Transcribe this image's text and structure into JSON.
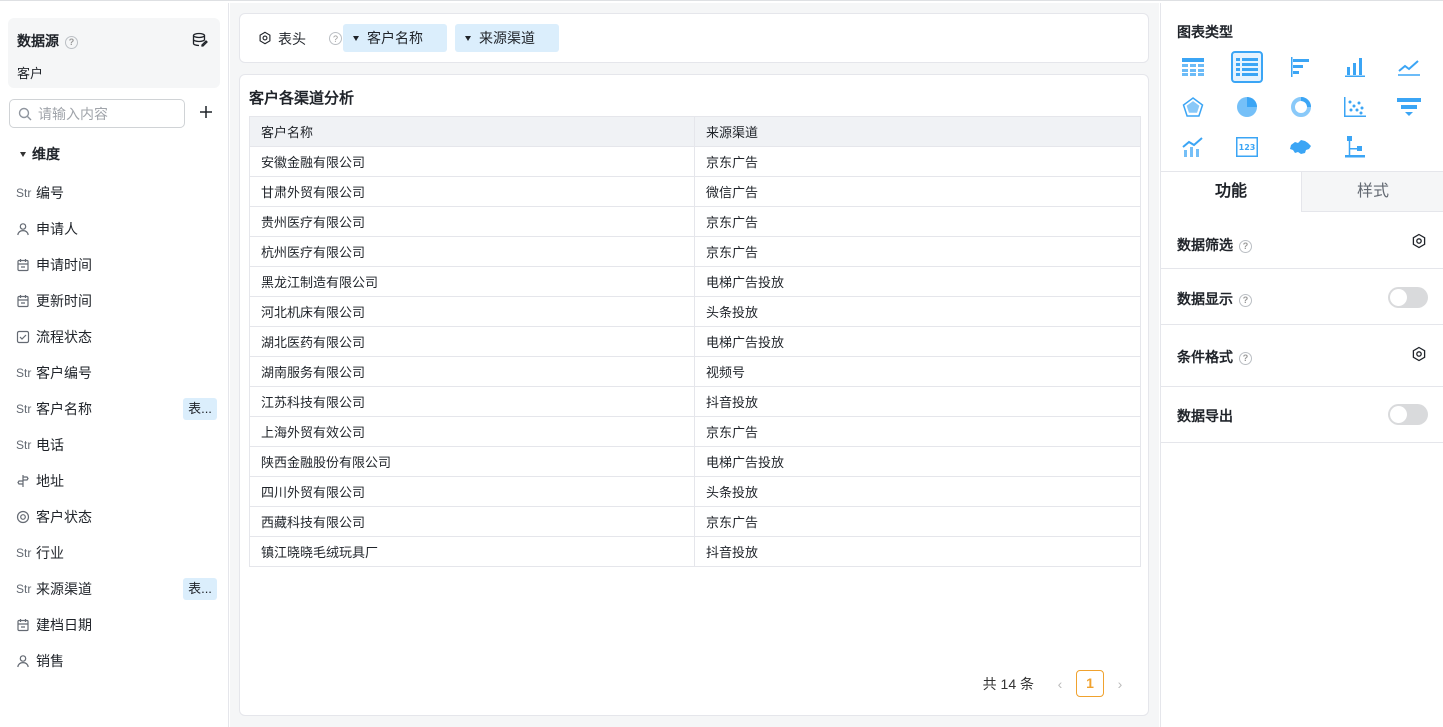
{
  "left": {
    "datasource_title": "数据源",
    "datasource_name": "客户",
    "search_placeholder": "请输入内容",
    "dimension_title": "维度",
    "fields": [
      {
        "type": "Str",
        "label": "编号",
        "tag": ""
      },
      {
        "type": "person-icon",
        "label": "申请人",
        "tag": ""
      },
      {
        "type": "calendar-icon",
        "label": "申请时间",
        "tag": ""
      },
      {
        "type": "calendar-icon",
        "label": "更新时间",
        "tag": ""
      },
      {
        "type": "checkbox-icon",
        "label": "流程状态",
        "tag": ""
      },
      {
        "type": "Str",
        "label": "客户编号",
        "tag": ""
      },
      {
        "type": "Str",
        "label": "客户名称",
        "tag": "表..."
      },
      {
        "type": "Str",
        "label": "电话",
        "tag": ""
      },
      {
        "type": "location-icon",
        "label": "地址",
        "tag": ""
      },
      {
        "type": "radio-icon",
        "label": "客户状态",
        "tag": ""
      },
      {
        "type": "Str",
        "label": "行业",
        "tag": ""
      },
      {
        "type": "Str",
        "label": "来源渠道",
        "tag": "表..."
      },
      {
        "type": "calendar-icon",
        "label": "建档日期",
        "tag": ""
      },
      {
        "type": "person-icon",
        "label": "销售",
        "tag": ""
      }
    ]
  },
  "header": {
    "label": "表头",
    "pills": [
      "客户名称",
      "来源渠道"
    ]
  },
  "table": {
    "title": "客户各渠道分析",
    "columns": [
      "客户名称",
      "来源渠道"
    ],
    "rows": [
      [
        "安徽金融有限公司",
        "京东广告"
      ],
      [
        "甘肃外贸有限公司",
        "微信广告"
      ],
      [
        "贵州医疗有限公司",
        "京东广告"
      ],
      [
        "杭州医疗有限公司",
        "京东广告"
      ],
      [
        "黑龙江制造有限公司",
        "电梯广告投放"
      ],
      [
        "河北机床有限公司",
        "头条投放"
      ],
      [
        "湖北医药有限公司",
        "电梯广告投放"
      ],
      [
        "湖南服务有限公司",
        "视频号"
      ],
      [
        "江苏科技有限公司",
        "抖音投放"
      ],
      [
        "上海外贸有效公司",
        "京东广告"
      ],
      [
        "陕西金融股份有限公司",
        "电梯广告投放"
      ],
      [
        "四川外贸有限公司",
        "头条投放"
      ],
      [
        "西藏科技有限公司",
        "京东广告"
      ],
      [
        "镇江晓晓毛绒玩具厂",
        "抖音投放"
      ]
    ],
    "total": "共 14 条",
    "page": "1"
  },
  "right": {
    "chart_type_title": "图表类型",
    "chart_types": [
      "table-icon",
      "detail-table-icon",
      "horizontal-bar-icon",
      "bar-chart-icon",
      "line-chart-icon",
      "radar-icon",
      "pie-icon",
      "donut-icon",
      "scatter-icon",
      "funnel-icon",
      "combo-chart-icon",
      "number-card-icon",
      "map-icon",
      "tree-icon"
    ],
    "selected_chart_type": "detail-table-icon",
    "tabs": [
      "功能",
      "样式"
    ],
    "functions": [
      {
        "label": "数据筛选",
        "help": true,
        "control": "gear"
      },
      {
        "label": "数据显示",
        "help": true,
        "control": "toggle"
      },
      {
        "label": "条件格式",
        "help": true,
        "control": "gear"
      },
      {
        "label": "数据导出",
        "help": false,
        "control": "toggle"
      }
    ],
    "accent_color": "#3ba5f5"
  }
}
